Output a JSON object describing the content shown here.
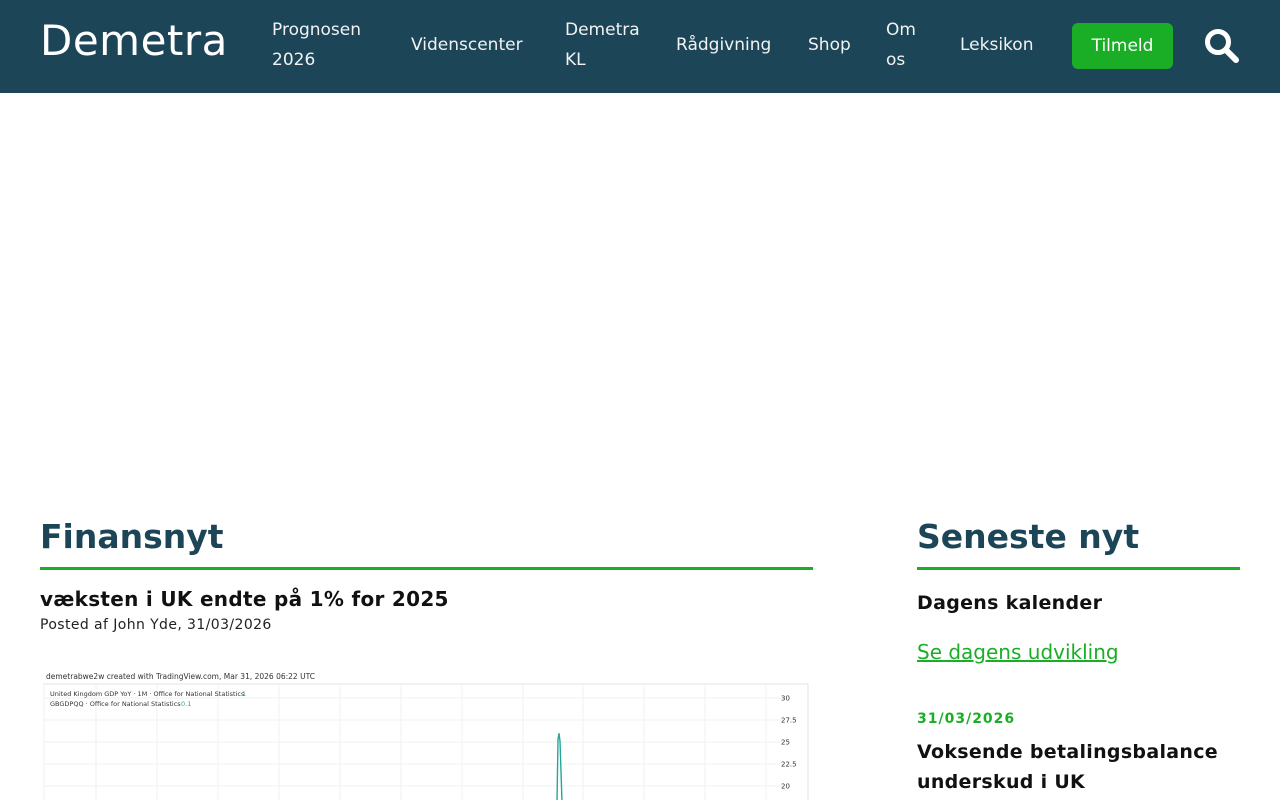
{
  "header": {
    "logo": "Demetra",
    "nav": {
      "prognosen": "Prognosen 2026",
      "videnscenter": "Videnscenter",
      "demetra_kl": "Demetra KL",
      "raadgivning": "Rådgivning",
      "shop": "Shop",
      "om_os": "Om os",
      "leksikon": "Leksikon"
    },
    "signup_button": "Tilmeld",
    "search_icon": "search-icon",
    "colors": {
      "background": "#1c4658",
      "button": "#1aae26",
      "text": "#ffffff"
    }
  },
  "main": {
    "section_title": "Finansnyt",
    "article": {
      "title": "væksten i UK endte på 1% for 2025",
      "meta": "Posted af John Yde, 31/03/2026"
    },
    "chart_image": {
      "caption": "demetrabwe2w created with TradingView.com, Mar 31, 2026 06:22 UTC",
      "legend_1": "United Kingdom GDP YoY · 1M · Office for National Statistics",
      "legend_1_value": "1",
      "legend_2": "GBGDPQQ · Office for National Statistics",
      "legend_2_value": "0.1",
      "y_ticks": [
        "30",
        "27.5",
        "25",
        "22.5",
        "20"
      ]
    }
  },
  "sidebar": {
    "section_title": "Seneste nyt",
    "calendar_heading": "Dagens kalender",
    "calendar_link": "Se dagens udvikling",
    "news_date": "31/03/2026",
    "news_title": "Voksende betalingsbalance underskud i UK"
  },
  "chart_data": {
    "type": "line",
    "title": "demetrabwe2w created with TradingView.com, Mar 31, 2026 06:22 UTC",
    "series": [
      {
        "name": "United Kingdom GDP YoY · 1M · Office for National Statistics",
        "last_value": 1,
        "color": "#26a69a"
      },
      {
        "name": "GBGDPQQ · Office for National Statistics",
        "last_value": 0.1,
        "color": "#26a69a"
      }
    ],
    "y_tick_labels": [
      "30",
      "27.5",
      "25",
      "22.5",
      "20"
    ],
    "visible_ylim": [
      20,
      30
    ],
    "peak_visible": 26,
    "grid": true
  }
}
